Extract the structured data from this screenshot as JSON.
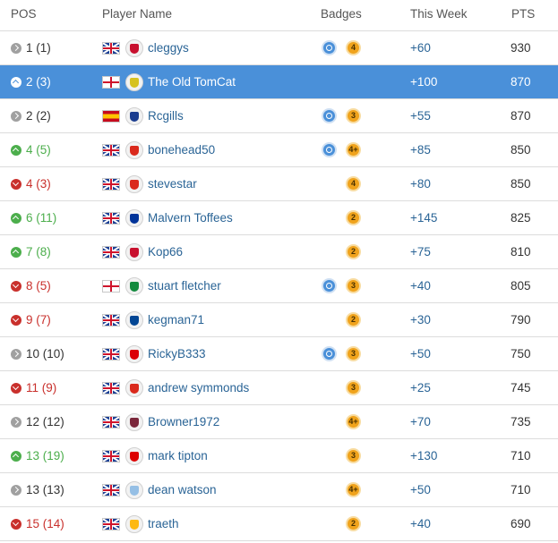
{
  "header": {
    "pos": "POS",
    "player": "Player Name",
    "badges": "Badges",
    "week": "This Week",
    "pts": "PTS"
  },
  "rows": [
    {
      "pos": "1 (1)",
      "trend": "same",
      "flag": "gb-flag-icon",
      "crest": "liverpool-crest-icon",
      "crest_color": "#c8102e",
      "name": "cleggys",
      "blue_badge": true,
      "gold_badge": "4",
      "week": "+60",
      "pts": "930"
    },
    {
      "pos": "2 (3)",
      "trend": "up",
      "flag": "england-flag-icon",
      "crest": "yellow-club-crest-icon",
      "crest_color": "#d6c21f",
      "name": "The Old TomCat",
      "blue_badge": false,
      "gold_badge": "",
      "week": "+100",
      "pts": "870",
      "highlight": true
    },
    {
      "pos": "2 (2)",
      "trend": "same",
      "flag": "spain-flag-icon",
      "crest": "blue-club-crest-icon",
      "crest_color": "#1b3d8f",
      "name": "Rcgills",
      "blue_badge": true,
      "gold_badge": "3",
      "week": "+55",
      "pts": "870"
    },
    {
      "pos": "4 (5)",
      "trend": "up",
      "flag": "gb-flag-icon",
      "crest": "cherry-crest-icon",
      "crest_color": "#da291c",
      "name": "bonehead50",
      "blue_badge": true,
      "gold_badge": "4+",
      "week": "+85",
      "pts": "850"
    },
    {
      "pos": "4 (3)",
      "trend": "down",
      "flag": "gb-flag-icon",
      "crest": "cherry-crest-icon",
      "crest_color": "#da291c",
      "name": "stevestar",
      "blue_badge": false,
      "gold_badge": "4",
      "week": "+80",
      "pts": "850"
    },
    {
      "pos": "6 (11)",
      "trend": "up",
      "flag": "gb-flag-icon",
      "crest": "everton-crest-icon",
      "crest_color": "#003399",
      "name": "Malvern Toffees",
      "blue_badge": false,
      "gold_badge": "2",
      "week": "+145",
      "pts": "825"
    },
    {
      "pos": "7 (8)",
      "trend": "up",
      "flag": "gb-flag-icon",
      "crest": "liverpool-crest-icon",
      "crest_color": "#c8102e",
      "name": "Kop66",
      "blue_badge": false,
      "gold_badge": "2",
      "week": "+75",
      "pts": "810"
    },
    {
      "pos": "8 (5)",
      "trend": "down",
      "flag": "england-flag-icon",
      "crest": "celtic-crest-icon",
      "crest_color": "#138a3e",
      "name": "stuart fletcher",
      "blue_badge": true,
      "gold_badge": "3",
      "week": "+40",
      "pts": "805"
    },
    {
      "pos": "9 (7)",
      "trend": "down",
      "flag": "gb-flag-icon",
      "crest": "chelsea-crest-icon",
      "crest_color": "#034694",
      "name": "kegman71",
      "blue_badge": false,
      "gold_badge": "2",
      "week": "+30",
      "pts": "790"
    },
    {
      "pos": "10 (10)",
      "trend": "same",
      "flag": "gb-flag-icon",
      "crest": "arsenal-crest-icon",
      "crest_color": "#db0007",
      "name": "RickyB333",
      "blue_badge": true,
      "gold_badge": "3",
      "week": "+50",
      "pts": "750"
    },
    {
      "pos": "11 (9)",
      "trend": "down",
      "flag": "gb-flag-icon",
      "crest": "man-utd-crest-icon",
      "crest_color": "#da291c",
      "name": "andrew symmonds",
      "blue_badge": false,
      "gold_badge": "3",
      "week": "+25",
      "pts": "745"
    },
    {
      "pos": "12 (12)",
      "trend": "same",
      "flag": "gb-flag-icon",
      "crest": "west-ham-crest-icon",
      "crest_color": "#7a263a",
      "name": "Browner1972",
      "blue_badge": false,
      "gold_badge": "4+",
      "week": "+70",
      "pts": "735"
    },
    {
      "pos": "13 (19)",
      "trend": "up",
      "flag": "gb-flag-icon",
      "crest": "nottingham-forest-crest-icon",
      "crest_color": "#dd0000",
      "name": "mark tipton",
      "blue_badge": false,
      "gold_badge": "3",
      "week": "+130",
      "pts": "710"
    },
    {
      "pos": "13 (13)",
      "trend": "same",
      "flag": "gb-flag-icon",
      "crest": "aston-villa-crest-icon",
      "crest_color": "#95bfe5",
      "name": "dean watson",
      "blue_badge": false,
      "gold_badge": "4+",
      "week": "+50",
      "pts": "710"
    },
    {
      "pos": "15 (14)",
      "trend": "down",
      "flag": "gb-flag-icon",
      "crest": "wolves-crest-icon",
      "crest_color": "#fdb913",
      "name": "traeth",
      "blue_badge": false,
      "gold_badge": "2",
      "week": "+40",
      "pts": "690"
    }
  ],
  "colors": {
    "highlight_row": "#4a90d9",
    "up": "#4cae4c",
    "down": "#c9302c",
    "same": "#a0a0a0",
    "link": "#2a6496",
    "gold_badge": "#f0a31c",
    "blue_badge": "#4a90d9"
  }
}
